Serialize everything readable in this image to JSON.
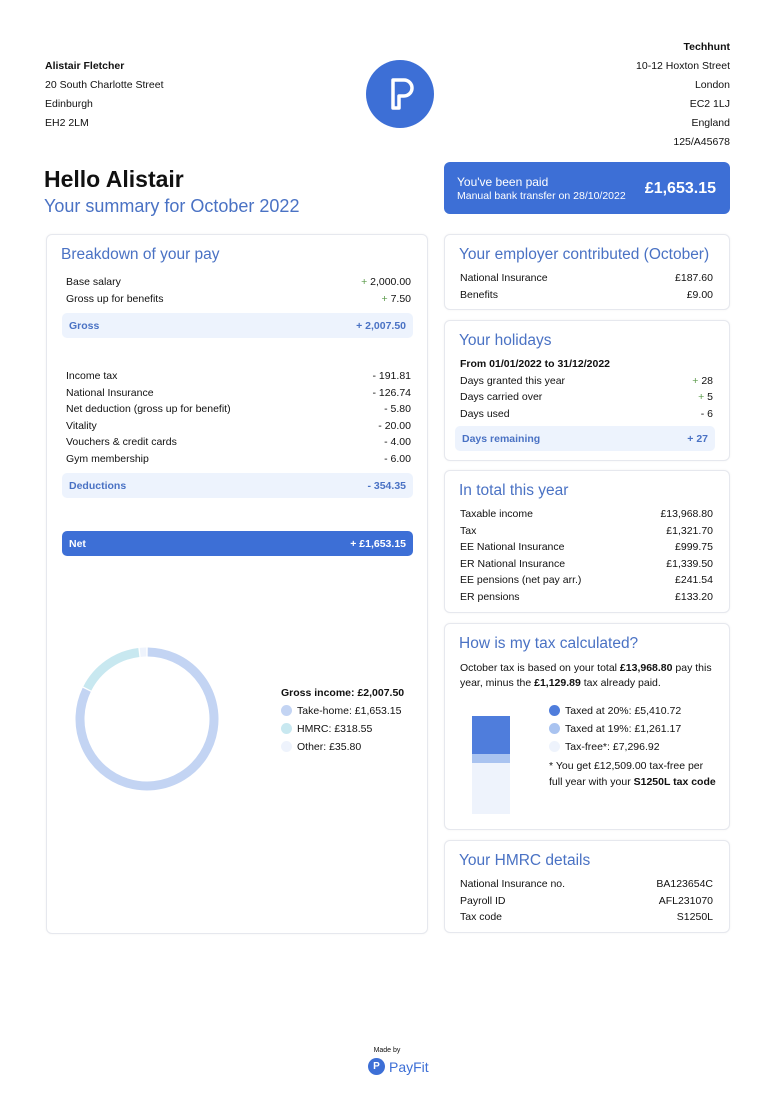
{
  "employee": {
    "name": "Alistair Fletcher",
    "lines": [
      "20 South Charlotte Street",
      "Edinburgh",
      "EH2 2LM"
    ]
  },
  "employer": {
    "name": "Techhunt",
    "lines": [
      "10-12 Hoxton Street",
      "London",
      "EC2 1LJ",
      "England",
      "125/A45678"
    ]
  },
  "greeting": "Hello Alistair",
  "summary_title": "Your summary for October 2022",
  "paid": {
    "title": "You've been paid",
    "subtitle": "Manual bank transfer on 28/10/2022",
    "amount": "£1,653.15"
  },
  "breakdown": {
    "title": "Breakdown of your pay",
    "earnings": [
      {
        "label": "Base salary",
        "sign": "+",
        "value": "2,000.00"
      },
      {
        "label": "Gross up for benefits",
        "sign": "+",
        "value": "7.50"
      }
    ],
    "gross": {
      "label": "Gross",
      "value": "+ 2,007.50"
    },
    "deductions": [
      {
        "label": "Income tax",
        "value": "- 191.81"
      },
      {
        "label": "National Insurance",
        "value": "- 126.74"
      },
      {
        "label": "Net deduction (gross up for benefit)",
        "value": "- 5.80"
      },
      {
        "label": "Vitality",
        "value": "- 20.00"
      },
      {
        "label": "Vouchers & credit cards",
        "value": "- 4.00"
      },
      {
        "label": "Gym membership",
        "value": "- 6.00"
      }
    ],
    "deductions_total": {
      "label": "Deductions",
      "value": "- 354.35"
    },
    "net": {
      "label": "Net",
      "value": "+ £1,653.15"
    }
  },
  "donut": {
    "title": "Gross income: £2,007.50",
    "items": [
      {
        "label": "Take-home: £1,653.15",
        "value": 1653.15,
        "color": "#c3d4f3"
      },
      {
        "label": "HMRC: £318.55",
        "value": 318.55,
        "color": "#c8e8f0"
      },
      {
        "label": "Other: £35.80",
        "value": 35.8,
        "color": "#eef3fc"
      }
    ]
  },
  "employer_contrib": {
    "title": "Your employer contributed (October)",
    "rows": [
      {
        "label": "National Insurance",
        "value": "£187.60"
      },
      {
        "label": "Benefits",
        "value": "£9.00"
      }
    ]
  },
  "holidays": {
    "title": "Your holidays",
    "period": "From 01/01/2022 to 31/12/2022",
    "rows": [
      {
        "label": "Days granted this year",
        "sign": "+",
        "value": "28"
      },
      {
        "label": "Days carried over",
        "sign": "+",
        "value": "5"
      },
      {
        "label": "Days used",
        "sign": "-",
        "value": "6"
      }
    ],
    "remaining": {
      "label": "Days remaining",
      "value": "+ 27"
    }
  },
  "total_year": {
    "title": "In total this year",
    "rows": [
      {
        "label": "Taxable income",
        "value": "£13,968.80"
      },
      {
        "label": "Tax",
        "value": "£1,321.70"
      },
      {
        "label": "EE National Insurance",
        "value": "£999.75"
      },
      {
        "label": "ER National Insurance",
        "value": "£1,339.50"
      },
      {
        "label": "EE pensions (net pay arr.)",
        "value": "£241.54"
      },
      {
        "label": "ER pensions",
        "value": "£133.20"
      }
    ]
  },
  "tax_calc": {
    "title": "How is my tax calculated?",
    "text1": "October tax is based on your total ",
    "bold1": "£13,968.80",
    "text2": " pay this year, minus the ",
    "bold2": "£1,129.89",
    "text3": " tax already paid.",
    "items": [
      {
        "label": "Taxed at 20%: £5,410.72",
        "value": 5410.72,
        "color": "#4f7ddc"
      },
      {
        "label": "Taxed at 19%: £1,261.17",
        "value": 1261.17,
        "color": "#a9c3f0"
      },
      {
        "label": "Tax-free*: £7,296.92",
        "value": 7296.92,
        "color": "#eef3fc"
      }
    ],
    "note1": "* You get £12,509.00 tax-free per full year with your ",
    "note_bold": "S1250L tax code"
  },
  "hmrc": {
    "title": "Your HMRC details",
    "rows": [
      {
        "label": "National Insurance no.",
        "value": "BA123654C"
      },
      {
        "label": "Payroll ID",
        "value": "AFL231070"
      },
      {
        "label": "Tax code",
        "value": "S1250L"
      }
    ]
  },
  "footer": {
    "made_by": "Made by",
    "brand": "PayFit"
  },
  "colors": {
    "accent": "#3d6fd6",
    "title": "#4a72c4"
  }
}
